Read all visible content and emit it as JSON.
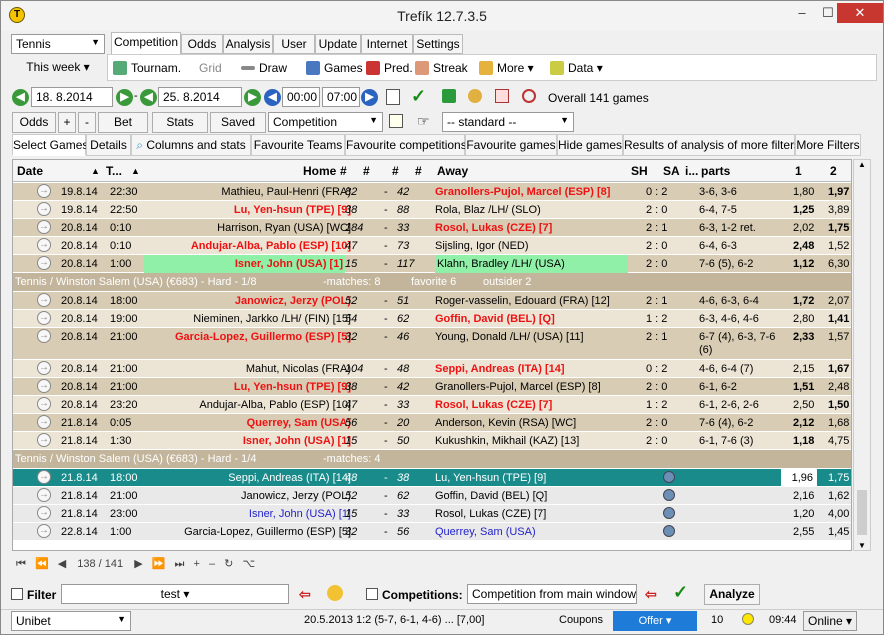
{
  "title": "Trefík 12.7.3.5",
  "sport": "Tennis",
  "period": "This week",
  "tabs": [
    "Competition",
    "Odds",
    "Analysis",
    "User",
    "Update",
    "Internet",
    "Settings"
  ],
  "toolbar": {
    "tournam": "Tournam.",
    "grid": "Grid",
    "draw": "Draw",
    "games": "Games",
    "pred": "Pred.",
    "streak": "Streak",
    "more": "More",
    "data": "Data"
  },
  "filters": {
    "date_from": "18. 8.2014",
    "date_to": "25. 8.2014",
    "time_from": "00:00",
    "time_to": "07:00",
    "overall": "Overall 141 games"
  },
  "buttons": {
    "odds": "Odds",
    "plus": "+",
    "minus": "-",
    "bet": "Bet",
    "stats": "Stats",
    "saved": "Saved",
    "competition": "Competition",
    "standard": "-- standard --"
  },
  "subtabs": [
    "Select Games",
    "Details",
    "Columns and stats",
    "Favourite Teams",
    "Favourite competitions",
    "Favourite games",
    "Hide games",
    "Results of analysis of more filters",
    "More Filters"
  ],
  "headers": {
    "date": "Date",
    "t": "T...",
    "home": "Home",
    "h1": "#",
    "h2": "#",
    "h3": "#",
    "h4": "#",
    "away": "Away",
    "sh": "SH",
    "sa": "SA",
    "i": "i...",
    "parts": "parts",
    "one": "1",
    "two": "2"
  },
  "rows": [
    {
      "date": "19.8.14",
      "time": "22:30",
      "home": "Mathieu, Paul-Henri (FRA)",
      "h1": "82",
      "h2": "42",
      "away": "Granollers-Pujol, Marcel (ESP) [8]",
      "sh": "0 : 2",
      "parts": "3-6, 3-6",
      "o1": "1,80",
      "o2": "1,97",
      "cls": "tan",
      "awaystyle": "red",
      "o2b": true
    },
    {
      "date": "19.8.14",
      "time": "22:50",
      "home": "Lu, Yen-hsun (TPE) [9]",
      "h1": "38",
      "h2": "88",
      "away": "Rola, Blaz /LH/ (SLO)",
      "sh": "2 : 0",
      "parts": "6-4, 7-5",
      "o1": "1,25",
      "o2": "3,89",
      "cls": "tan2",
      "homestyle": "red",
      "o1b": true
    },
    {
      "date": "20.8.14",
      "time": "0:10",
      "home": "Harrison, Ryan (USA) [WC]",
      "h1": "184",
      "h2": "33",
      "away": "Rosol, Lukas (CZE) [7]",
      "sh": "2 : 1",
      "parts": "6-3, 1-2 ret.",
      "o1": "2,02",
      "o2": "1,75",
      "cls": "tan",
      "awaystyle": "red",
      "o2b": true
    },
    {
      "date": "20.8.14",
      "time": "0:10",
      "home": "Andujar-Alba, Pablo (ESP) [10]",
      "h1": "47",
      "h2": "73",
      "away": "Sijsling, Igor (NED)",
      "sh": "2 : 0",
      "parts": "6-4, 6-3",
      "o1": "2,48",
      "o2": "1,52",
      "cls": "tan2",
      "homestyle": "red",
      "o1b": true
    },
    {
      "date": "20.8.14",
      "time": "1:00",
      "home": "Isner, John (USA) [1]",
      "h1": "15",
      "h2": "117",
      "away": "Klahn, Bradley /LH/ (USA)",
      "sh": "2 : 0",
      "parts": "7-6 (5), 6-2",
      "o1": "1,12",
      "o2": "6,30",
      "cls": "tan",
      "homestyle": "red",
      "green": true,
      "o1b": true
    }
  ],
  "sep1": {
    "name": "Tennis / Winston Salem (USA) (€683) - Hard - 1/8",
    "matches": "-matches: 8",
    "fav": "favorite 6",
    "out": "outsider 2"
  },
  "rows2": [
    {
      "date": "20.8.14",
      "time": "18:00",
      "home": "Janowicz, Jerzy (POL)",
      "h1": "52",
      "h2": "51",
      "away": "Roger-vasselin, Edouard (FRA) [12]",
      "sh": "2 : 1",
      "parts": "4-6, 6-3, 6-4",
      "o1": "1,72",
      "o2": "2,07",
      "cls": "tan",
      "homestyle": "red",
      "o1b": true
    },
    {
      "date": "20.8.14",
      "time": "19:00",
      "home": "Nieminen, Jarkko /LH/ (FIN) [15]",
      "h1": "54",
      "h2": "62",
      "away": "Goffin, David (BEL) [Q]",
      "sh": "1 : 2",
      "parts": "6-3, 4-6, 4-6",
      "o1": "2,80",
      "o2": "1,41",
      "cls": "tan2",
      "awaystyle": "red",
      "o2b": true
    },
    {
      "date": "20.8.14",
      "time": "21:00",
      "home": "Garcia-Lopez, Guillermo (ESP) [5]",
      "h1": "32",
      "h2": "46",
      "away": "Young, Donald /LH/ (USA) [11]",
      "sh": "2 : 1",
      "parts": "6-7 (4), 6-3, 7-6 (6)",
      "o1": "2,33",
      "o2": "1,57",
      "cls": "tan",
      "homestyle": "red",
      "tall": true,
      "o1b": true
    },
    {
      "date": "20.8.14",
      "time": "21:00",
      "home": "Mahut, Nicolas (FRA)",
      "h1": "104",
      "h2": "48",
      "away": "Seppi, Andreas (ITA) [14]",
      "sh": "0 : 2",
      "parts": "4-6, 6-4 (7)",
      "o1": "2,15",
      "o2": "1,67",
      "cls": "tan2",
      "awaystyle": "red",
      "o2b": true
    },
    {
      "date": "20.8.14",
      "time": "21:00",
      "home": "Lu, Yen-hsun (TPE) [9]",
      "h1": "38",
      "h2": "42",
      "away": "Granollers-Pujol, Marcel (ESP) [8]",
      "sh": "2 : 0",
      "parts": "6-1, 6-2",
      "o1": "1,51",
      "o2": "2,48",
      "cls": "tan",
      "homestyle": "red",
      "o1b": true
    },
    {
      "date": "20.8.14",
      "time": "23:20",
      "home": "Andujar-Alba, Pablo (ESP) [10]",
      "h1": "47",
      "h2": "33",
      "away": "Rosol, Lukas (CZE) [7]",
      "sh": "1 : 2",
      "parts": "6-1, 2-6, 2-6",
      "o1": "2,50",
      "o2": "1,50",
      "cls": "tan2",
      "awaystyle": "red",
      "o2b": true
    },
    {
      "date": "21.8.14",
      "time": "0:05",
      "home": "Querrey, Sam (USA)",
      "h1": "56",
      "h2": "20",
      "away": "Anderson, Kevin (RSA) [WC]",
      "sh": "2 : 0",
      "parts": "7-6 (4), 6-2",
      "o1": "2,12",
      "o2": "1,68",
      "cls": "tan",
      "homestyle": "red",
      "o1b": true
    },
    {
      "date": "21.8.14",
      "time": "1:30",
      "home": "Isner, John (USA) [1]",
      "h1": "15",
      "h2": "50",
      "away": "Kukushkin, Mikhail (KAZ) [13]",
      "sh": "2 : 0",
      "parts": "6-1, 7-6 (3)",
      "o1": "1,18",
      "o2": "4,75",
      "cls": "tan2",
      "homestyle": "red",
      "o1b": true
    }
  ],
  "sep2": {
    "name": "Tennis / Winston Salem (USA) (€683) - Hard - 1/4",
    "matches": "-matches: 4"
  },
  "rows3": [
    {
      "date": "21.8.14",
      "time": "18:00",
      "home": "Seppi, Andreas (ITA) [14]",
      "h1": "48",
      "h2": "38",
      "away": "Lu, Yen-hsun (TPE) [9]",
      "o1": "1,96",
      "o2": "1,75",
      "cls": "sel"
    },
    {
      "date": "21.8.14",
      "time": "21:00",
      "home": "Janowicz, Jerzy (POL)",
      "h1": "52",
      "h2": "62",
      "away": "Goffin, David (BEL) [Q]",
      "o1": "2,16",
      "o2": "1,62",
      "cls": "grey"
    },
    {
      "date": "21.8.14",
      "time": "23:00",
      "home": "Isner, John (USA) [1]",
      "h1": "15",
      "h2": "33",
      "away": "Rosol, Lukas (CZE) [7]",
      "o1": "1,20",
      "o2": "4,00",
      "cls": "grey",
      "homestyle": "blue"
    },
    {
      "date": "22.8.14",
      "time": "1:00",
      "home": "Garcia-Lopez, Guillermo (ESP) [5]",
      "h1": "32",
      "h2": "56",
      "away": "Querrey, Sam (USA)",
      "o1": "2,55",
      "o2": "1,45",
      "cls": "grey",
      "awaystyle": "blue"
    }
  ],
  "nav": {
    "pos": "138 / 141"
  },
  "bottom": {
    "filter": "Filter",
    "test": "test",
    "competitions": "Competitions:",
    "comp_sel": "Competition from main window",
    "analyze": "Analyze"
  },
  "status": {
    "bookmaker": "Unibet",
    "result": "20.5.2013 1:2 (5-7, 6-1, 4-6) ... [7,00]",
    "coupons": "Coupons",
    "offer": "Offer",
    "count": "10",
    "time": "09:44",
    "online": "Online"
  },
  "colors": {
    "tan": "#d8ccb4",
    "sel": "#1a8b8b",
    "red": "#e11111",
    "blue": "#2222cc"
  }
}
